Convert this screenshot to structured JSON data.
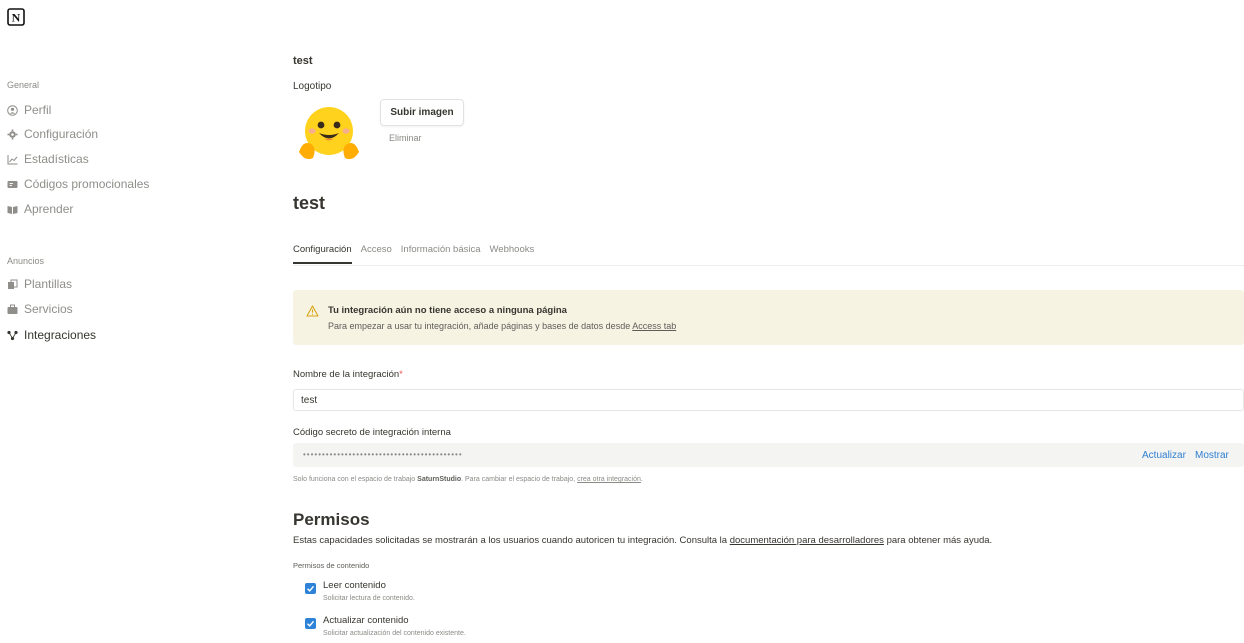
{
  "sidebar": {
    "sections": [
      {
        "title": "General",
        "items": [
          {
            "label": "Perfil",
            "icon": "user-circle-icon"
          },
          {
            "label": "Configuración",
            "icon": "gear-icon"
          },
          {
            "label": "Estadísticas",
            "icon": "chart-icon"
          },
          {
            "label": "Códigos promocionales",
            "icon": "ticket-icon"
          },
          {
            "label": "Aprender",
            "icon": "book-icon"
          }
        ]
      },
      {
        "title": "Anuncios",
        "items": [
          {
            "label": "Plantillas",
            "icon": "template-icon"
          },
          {
            "label": "Servicios",
            "icon": "briefcase-icon"
          },
          {
            "label": "Integraciones",
            "icon": "integrations-icon",
            "active": true
          }
        ]
      }
    ]
  },
  "main": {
    "name_small": "test",
    "logo_label": "Logotipo",
    "upload_label": "Subir imagen",
    "remove_label": "Eliminar",
    "title": "test",
    "tabs": [
      "Configuración",
      "Acceso",
      "Información básica",
      "Webhooks"
    ],
    "warning": {
      "title": "Tu integración aún no tiene acceso a ninguna página",
      "body": "Para empezar a usar tu integración, añade páginas y bases de datos desde",
      "link": "Access tab"
    },
    "integration_name_label": "Nombre de la integración",
    "required_mark": "*",
    "integration_name_value": "test",
    "secret_label": "Código secreto de integración interna",
    "secret_value": "••••••••••••••••••••••••••••••••••••••••••",
    "refresh_label": "Actualizar",
    "show_label": "Mostrar",
    "secret_note_1": "Solo funciona con el espacio de trabajo",
    "workspace": "SaturnStudio",
    "secret_note_2": ". Para cambiar el espacio de trabajo,",
    "secret_note_link": "crea otra integración",
    "secret_note_end": ".",
    "permissions_title": "Permisos",
    "permissions_desc_1": "Estas capacidades solicitadas se mostrarán a los usuarios cuando autoricen tu integración. Consulta la",
    "permissions_link": "documentación para desarrolladores",
    "permissions_desc_2": "para obtener más ayuda.",
    "content_perms_label": "Permisos de contenido",
    "perms": [
      {
        "label": "Leer contenido",
        "desc": "Solicitar lectura de contenido.",
        "checked": true
      },
      {
        "label": "Actualizar contenido",
        "desc": "Solicitar actualización del contenido existente.",
        "checked": true
      }
    ]
  }
}
